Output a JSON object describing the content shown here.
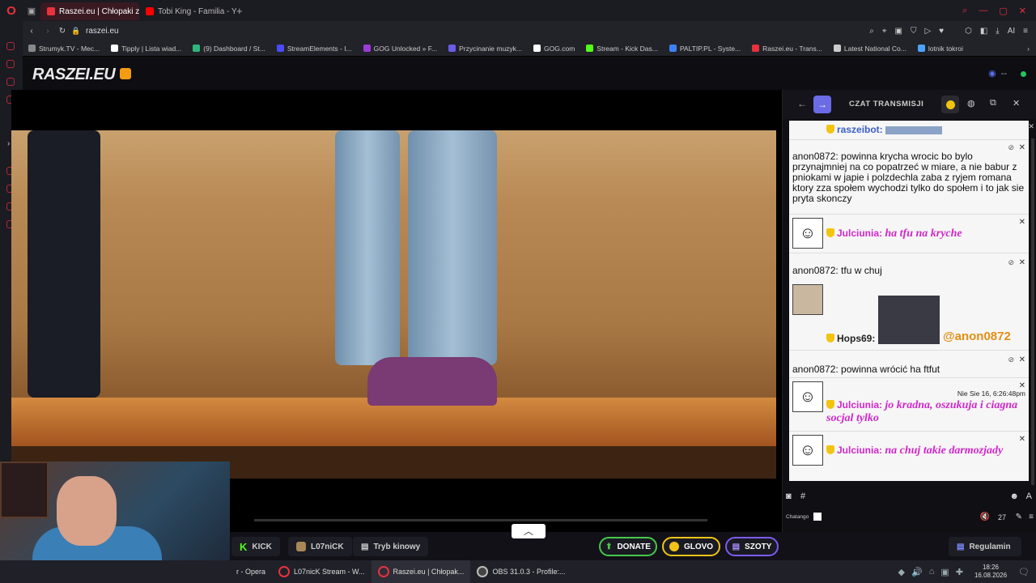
{
  "browser": {
    "tabs": [
      {
        "label": "Raszei.eu | Chłopaki z",
        "active": true,
        "color": "#e8323c"
      },
      {
        "label": "Tobi King - Familia - YouTu",
        "active": false,
        "color": "#ff0000"
      }
    ],
    "address": "raszei.eu",
    "bookmarks": [
      {
        "label": "Strumyk.TV - Mec...",
        "color": "#888"
      },
      {
        "label": "Tipply | Lista wiad...",
        "color": "#fff"
      },
      {
        "label": "(9) Dashboard / St...",
        "color": "#2eb67d"
      },
      {
        "label": "StreamElements - I...",
        "color": "#4a4aff"
      },
      {
        "label": "GOG Unlocked » F...",
        "color": "#9b3cd8"
      },
      {
        "label": "Przycinanie muzyk...",
        "color": "#6c5ce7"
      },
      {
        "label": "GOG.com",
        "color": "#fff"
      },
      {
        "label": "Stream - Kick Das...",
        "color": "#53fc18"
      },
      {
        "label": "PALTIP.PL - Syste...",
        "color": "#3b82f6"
      },
      {
        "label": "Raszei.eu - Trans...",
        "color": "#e8323c"
      },
      {
        "label": "Latest National Co...",
        "color": "#ccc"
      },
      {
        "label": "lotnik tokroi",
        "color": "#4aa3ff"
      }
    ]
  },
  "site": {
    "logo": "RASZEI.EU",
    "viewers": "--"
  },
  "chat": {
    "title": "CZAT TRANSMISJI",
    "messages": {
      "m1_nick": "raszeibot:",
      "m2_text": "anon0872: powinna krycha wrocic bo bylo przynajmniej na co popatrzeć w miare, a nie babur z pniokami w japie i polzdechla zaba z ryjem romana ktory zza społem wychodzi tylko do społem i to jak sie pryta skonczy",
      "m3_nick": "Julciunia:",
      "m3_text": "ha tfu na kryche",
      "m4_text": "anon0872: tfu w chuj",
      "m5_nick": "Hops69:",
      "m5_mention": "@anon0872",
      "m6_text": "anon0872: powinna wrócić ha ftfut",
      "m7_time": "Nie Sie 16, 6:26:48pm",
      "m7_nick": "Julciunia:",
      "m7_text": "jo kradna, oszukuja i ciagna socjal tylko",
      "m8_nick": "Julciunia:",
      "m8_text": "na chuj takie darmozjady"
    },
    "input_label": "Chatango",
    "volume": "27"
  },
  "bottombar": {
    "kick": "KICK",
    "l07nick": "L07niCK",
    "cinema": "Tryb kinowy",
    "donate": "DONATE",
    "glovo": "GLOVO",
    "szoty": "SZOTY",
    "rules": "Regulamin"
  },
  "taskbar": {
    "items": [
      {
        "label": "r - Opera",
        "color": "#e8323c"
      },
      {
        "label": "L07nicK Stream - W...",
        "color": "#e8323c"
      },
      {
        "label": "Raszei.eu | Chłopak...",
        "color": "#e8323c"
      },
      {
        "label": "OBS 31.0.3 - Profile:...",
        "color": "#444"
      }
    ],
    "time": "18:26",
    "date": "16.08.2026"
  }
}
